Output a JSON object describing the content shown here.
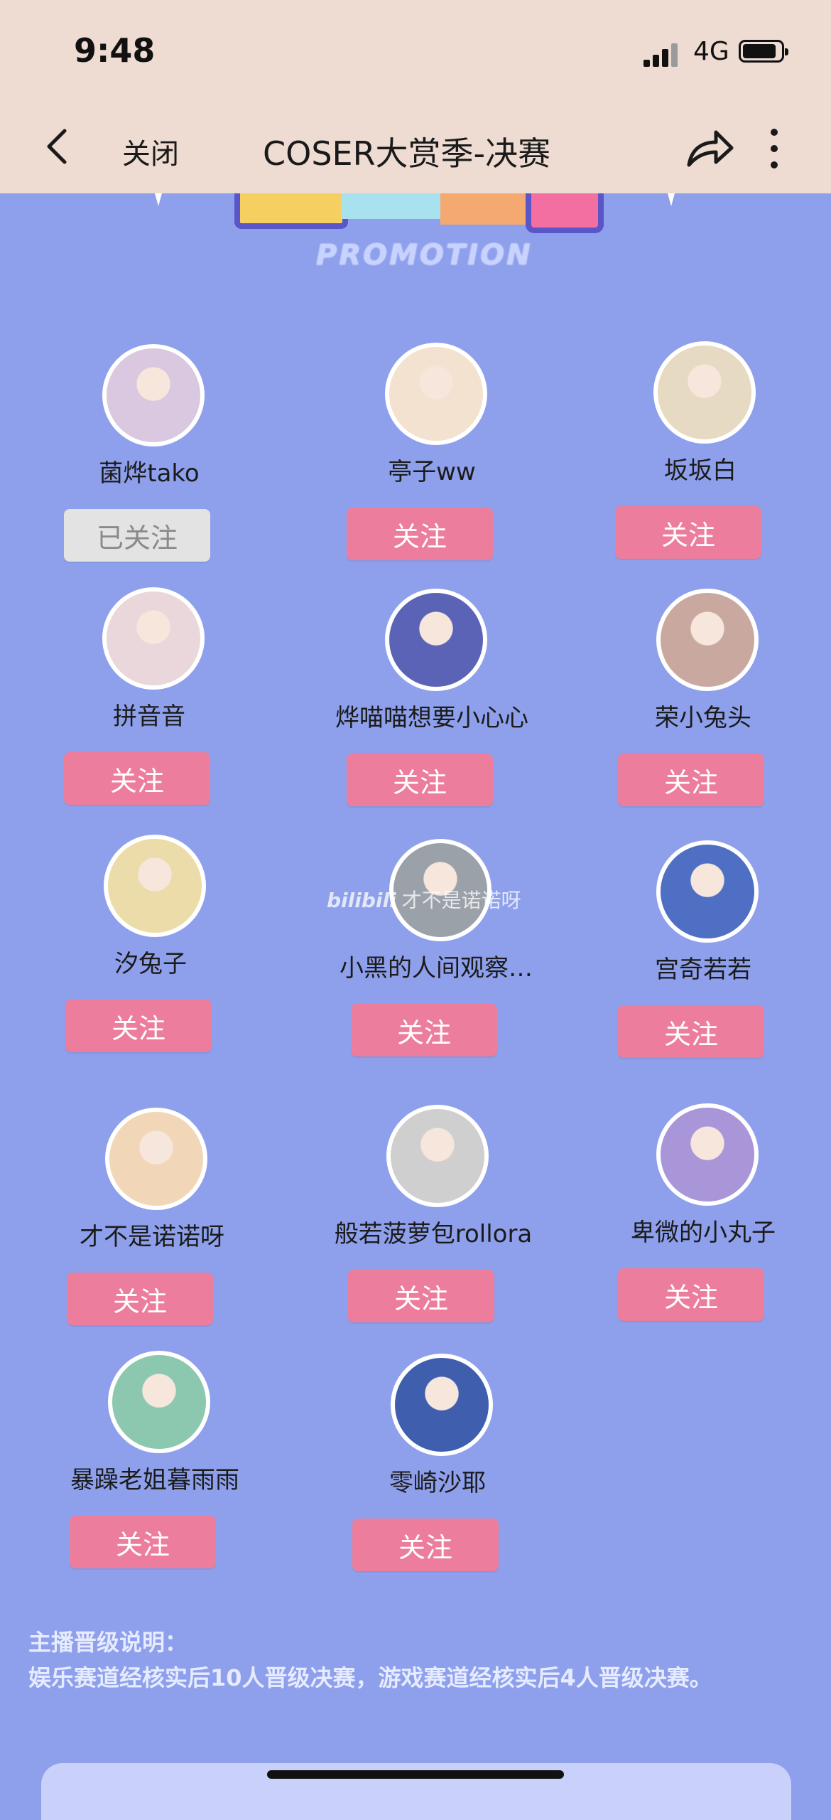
{
  "status": {
    "time": "9:48",
    "network": "4G"
  },
  "nav": {
    "close_label": "关闭",
    "title": "COSER大赏季-决赛"
  },
  "banner": {
    "subtitle": "PROMOTION"
  },
  "watermark": {
    "brand": "bilibili",
    "text": "才不是诺诺呀"
  },
  "streamers": [
    {
      "name": "菌烨tako",
      "button": "已关注",
      "followed": true,
      "avatar_color": "#d9c8e0"
    },
    {
      "name": "亭子ww",
      "button": "关注",
      "followed": false,
      "avatar_color": "#f3e2cf"
    },
    {
      "name": "坂坂白",
      "button": "关注",
      "followed": false,
      "avatar_color": "#e7dac2"
    },
    {
      "name": "拼音音",
      "button": "关注",
      "followed": false,
      "avatar_color": "#ead7db"
    },
    {
      "name": "烨喵喵想要小心心",
      "button": "关注",
      "followed": false,
      "avatar_color": "#5a63b6"
    },
    {
      "name": "荣小兔头",
      "button": "关注",
      "followed": false,
      "avatar_color": "#c9a8a0"
    },
    {
      "name": "汐兔子",
      "button": "关注",
      "followed": false,
      "avatar_color": "#ecdcaa"
    },
    {
      "name": "小黑的人间观察…",
      "button": "关注",
      "followed": false,
      "avatar_color": "#9aa1a8"
    },
    {
      "name": "宫奇若若",
      "button": "关注",
      "followed": false,
      "avatar_color": "#4e6fc4"
    },
    {
      "name": "才不是诺诺呀",
      "button": "关注",
      "followed": false,
      "avatar_color": "#f2d6b8"
    },
    {
      "name": "般若菠萝包rollora",
      "button": "关注",
      "followed": false,
      "avatar_color": "#cfcfcf"
    },
    {
      "name": "卑微的小丸子",
      "button": "关注",
      "followed": false,
      "avatar_color": "#a896d9"
    },
    {
      "name": "暴躁老姐暮雨雨",
      "button": "关注",
      "followed": false,
      "avatar_color": "#8cc7b0"
    },
    {
      "name": "零崎沙耶",
      "button": "关注",
      "followed": false,
      "avatar_color": "#3f5fae"
    }
  ],
  "rules": {
    "heading": "主播晋级说明：",
    "text": "娱乐赛道经核实后10人晋级决赛，游戏赛道经核实后4人晋级决赛。"
  },
  "colors": {
    "accent": "#ec7d9c",
    "background": "#8ea0ec",
    "header": "#eedcd3"
  }
}
